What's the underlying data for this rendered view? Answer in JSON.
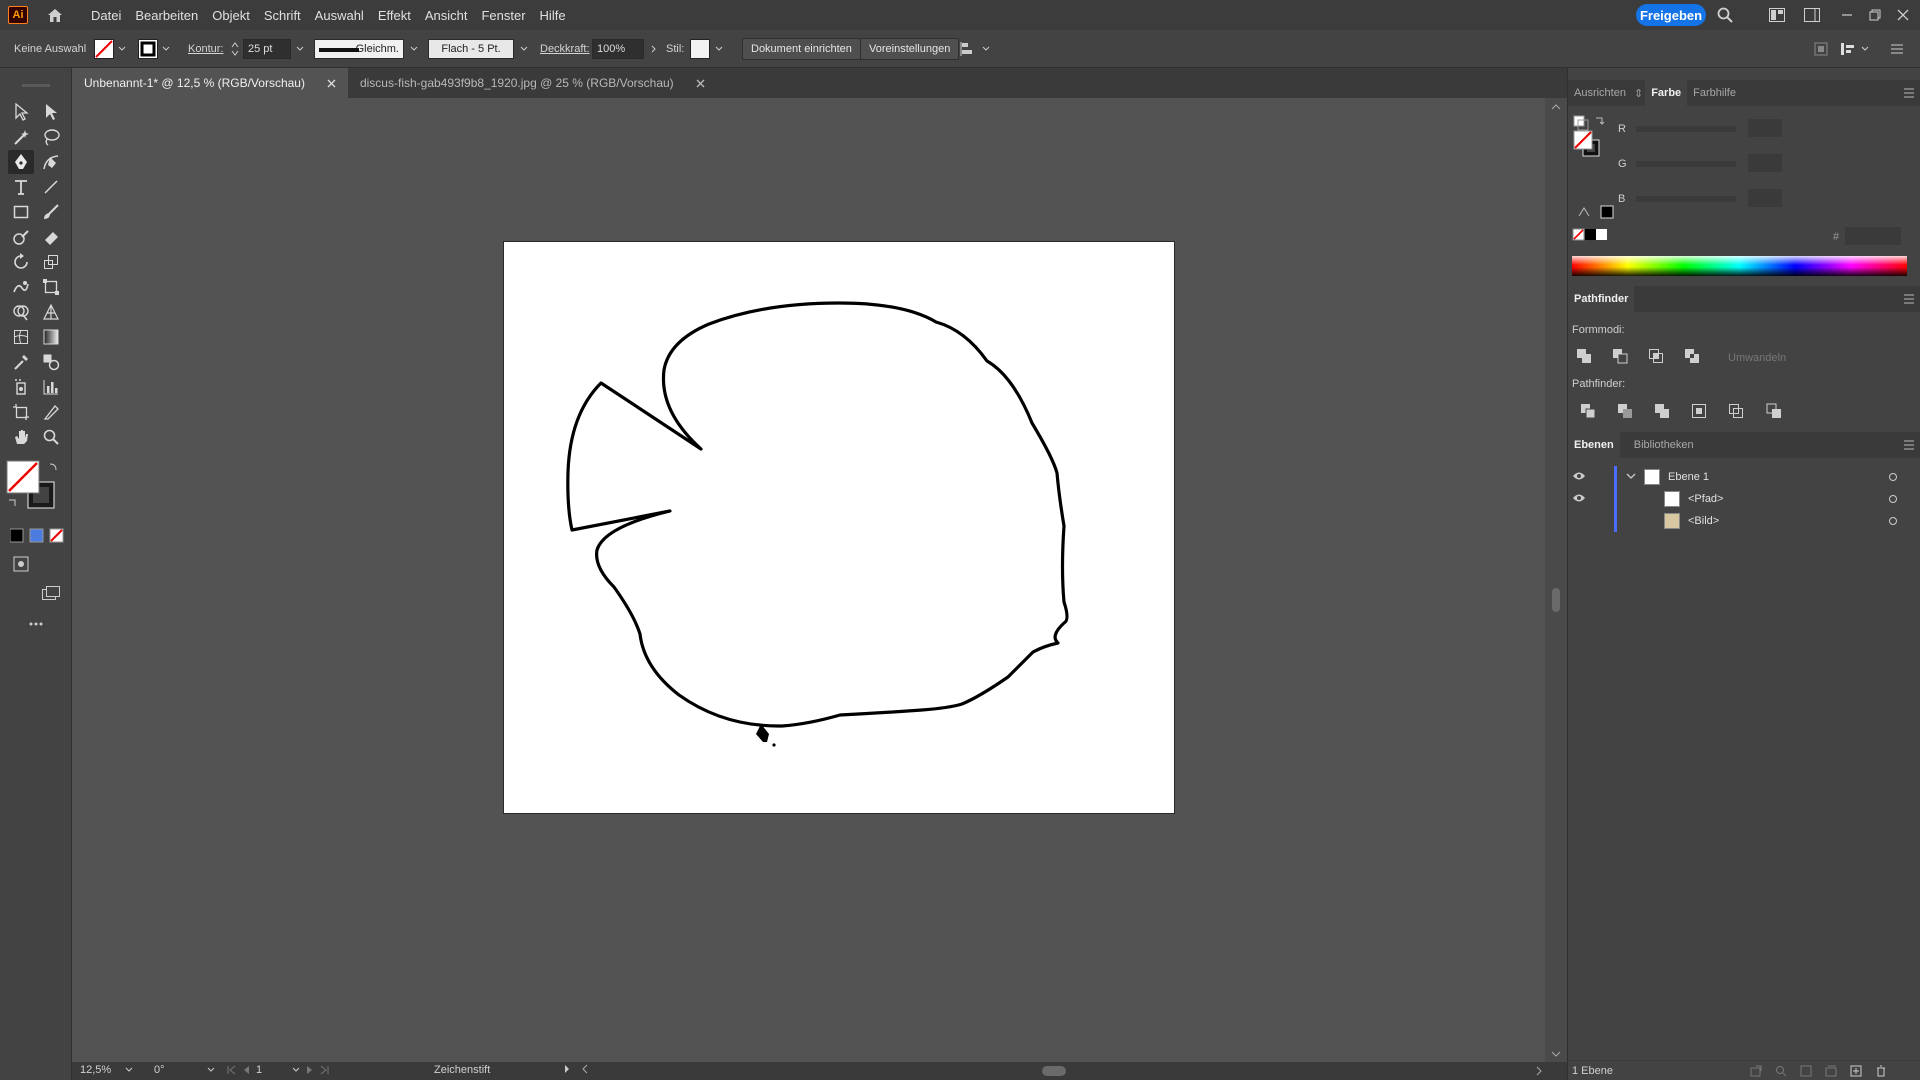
{
  "app": {
    "logo_text": "Ai",
    "share_label": "Freigeben"
  },
  "menus": [
    "Datei",
    "Bearbeiten",
    "Objekt",
    "Schrift",
    "Auswahl",
    "Effekt",
    "Ansicht",
    "Fenster",
    "Hilfe"
  ],
  "control_bar": {
    "selection": "Keine Auswahl",
    "stroke_label": "Kontur:",
    "stroke_value": "25 pt",
    "line_style": "Gleichm.",
    "brush": "Flach - 5 Pt.",
    "opacity_label": "Deckkraft:",
    "opacity_value": "100%",
    "style_label": "Stil:",
    "document_setup": "Dokument einrichten",
    "preferences": "Voreinstellungen"
  },
  "tabs": [
    {
      "label": "Unbenannt-1* @ 12,5 % (RGB/Vorschau)",
      "active": true
    },
    {
      "label": "discus-fish-gab493f9b8_1920.jpg @ 25 % (RGB/Vorschau)",
      "active": false
    }
  ],
  "status": {
    "zoom": "12,5%",
    "rotation": "0°",
    "artboard": "1",
    "tool": "Zeichenstift"
  },
  "color_panel": {
    "tabs": [
      "Ausrichten",
      "Farbe",
      "Farbhilfe"
    ],
    "active_tab": "Farbe",
    "channels": [
      "R",
      "G",
      "B"
    ],
    "hex_label": "#"
  },
  "pathfinder": {
    "title": "Pathfinder",
    "shape_modes_label": "Formmodi:",
    "pathfinders_label": "Pathfinder:",
    "expand_label": "Umwandeln"
  },
  "layers_panel": {
    "tabs": [
      "Ebenen",
      "Bibliotheken"
    ],
    "layers": [
      {
        "name": "Ebene 1",
        "visible": true
      },
      {
        "name": "<Pfad>",
        "visible": true
      },
      {
        "name": "<Bild>",
        "visible": false
      }
    ],
    "footer": "1 Ebene"
  },
  "colors": {
    "accent": "#1473e6",
    "layer_color": "#4a6cff",
    "canvas": "#ffffff",
    "pasteboard": "#535353"
  }
}
